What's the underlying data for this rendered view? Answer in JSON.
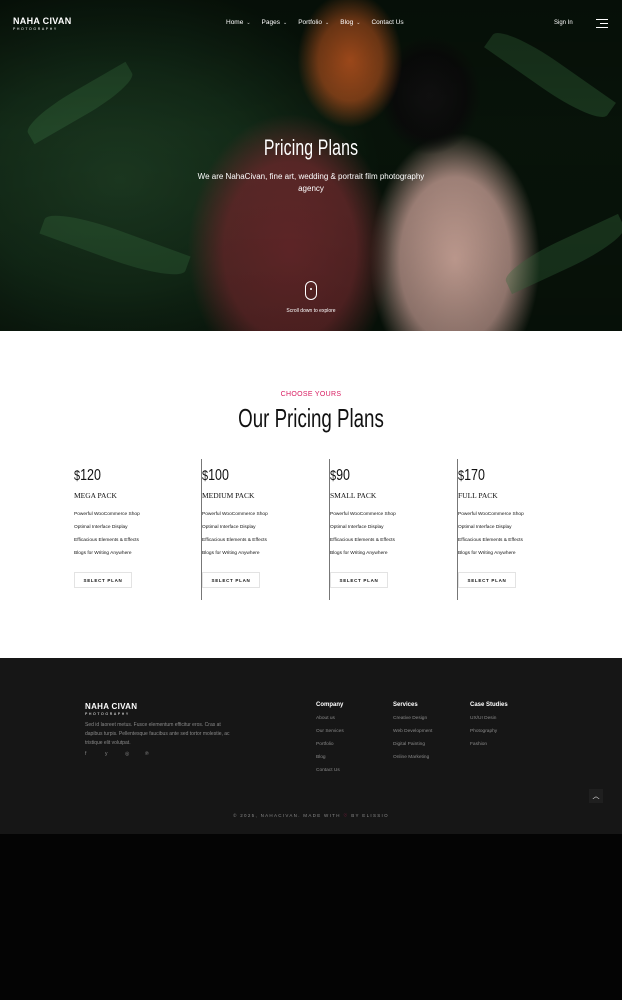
{
  "brand": {
    "name": "NAHA CIVAN",
    "tagline": "PHOTOGRAPHY"
  },
  "nav": {
    "items": [
      {
        "label": "Home",
        "has_dropdown": true
      },
      {
        "label": "Pages",
        "has_dropdown": true
      },
      {
        "label": "Portfolio",
        "has_dropdown": true
      },
      {
        "label": "Blog",
        "has_dropdown": true
      },
      {
        "label": "Contact Us",
        "has_dropdown": false
      }
    ],
    "sign_in": "Sign In",
    "menu_icon": "hamburger-icon"
  },
  "hero": {
    "title": "Pricing Plans",
    "subtitle": "We are NahaCivan, fine art, wedding & portrait film photography agency",
    "scroll_label": "Scroll down to explore"
  },
  "pricing": {
    "eyebrow": "CHOOSE YOURS",
    "title": "Our Pricing Plans",
    "plans": [
      {
        "currency": "$",
        "amount": "120",
        "name": "MEGA PACK",
        "features": [
          "Powerful WooCommerce Shop",
          "Optimal Interface Display",
          "Efficacious Elements & Effects",
          "Blogs for Writing Anywhere"
        ],
        "button": "SELECT PLAN"
      },
      {
        "currency": "$",
        "amount": "100",
        "name": "MEDIUM PACK",
        "features": [
          "Powerful WooCommerce Shop",
          "Optimal Interface Display",
          "Efficacious Elements & Effects",
          "Blogs for Writing Anywhere"
        ],
        "button": "SELECT PLAN"
      },
      {
        "currency": "$",
        "amount": "90",
        "name": "SMALL PACK",
        "features": [
          "Powerful WooCommerce Shop",
          "Optimal Interface Display",
          "Efficacious Elements & Effects",
          "Blogs for Writing Anywhere"
        ],
        "button": "SELECT PLAN"
      },
      {
        "currency": "$",
        "amount": "170",
        "name": "FULL PACK",
        "features": [
          "Powerful WooCommerce Shop",
          "Optimal Interface Display",
          "Efficacious Elements & Effects",
          "Blogs for Writing Anywhere"
        ],
        "button": "SELECT PLAN"
      }
    ]
  },
  "footer": {
    "brand": "NAHA CIVAN",
    "brand_tagline": "PHOTOGRAPHY",
    "about": "Sed id laoreet metus. Fusce elementum efficitur eros. Cras at dapibus turpis. Pellentesque faucibus ante sed tortor molestie, ac tristique elit volutpat.",
    "socials": [
      {
        "icon": "facebook-icon",
        "glyph": "f"
      },
      {
        "icon": "twitter-icon",
        "glyph": "y"
      },
      {
        "icon": "instagram-icon",
        "glyph": "◎"
      },
      {
        "icon": "pinterest-icon",
        "glyph": "℗"
      }
    ],
    "columns": [
      {
        "title": "Company",
        "links": [
          "About us",
          "Our Services",
          "Portfolio",
          "Blog",
          "Contact Us"
        ]
      },
      {
        "title": "Services",
        "links": [
          "Creative Design",
          "Web Development",
          "Digital Painting",
          "Online Marketing"
        ]
      },
      {
        "title": "Case Studies",
        "links": [
          "UX/UI Desin",
          "Photography",
          "Fashion"
        ]
      }
    ],
    "copyright_prefix": "© 2025, NAHACIVAN. MADE WITH",
    "copyright_suffix": "BY ELISSIO",
    "back_to_top_icon": "chevron-up-icon"
  },
  "colors": {
    "accent": "#d81b60",
    "footer_bg": "#161616",
    "page_bottom": "#040404"
  }
}
